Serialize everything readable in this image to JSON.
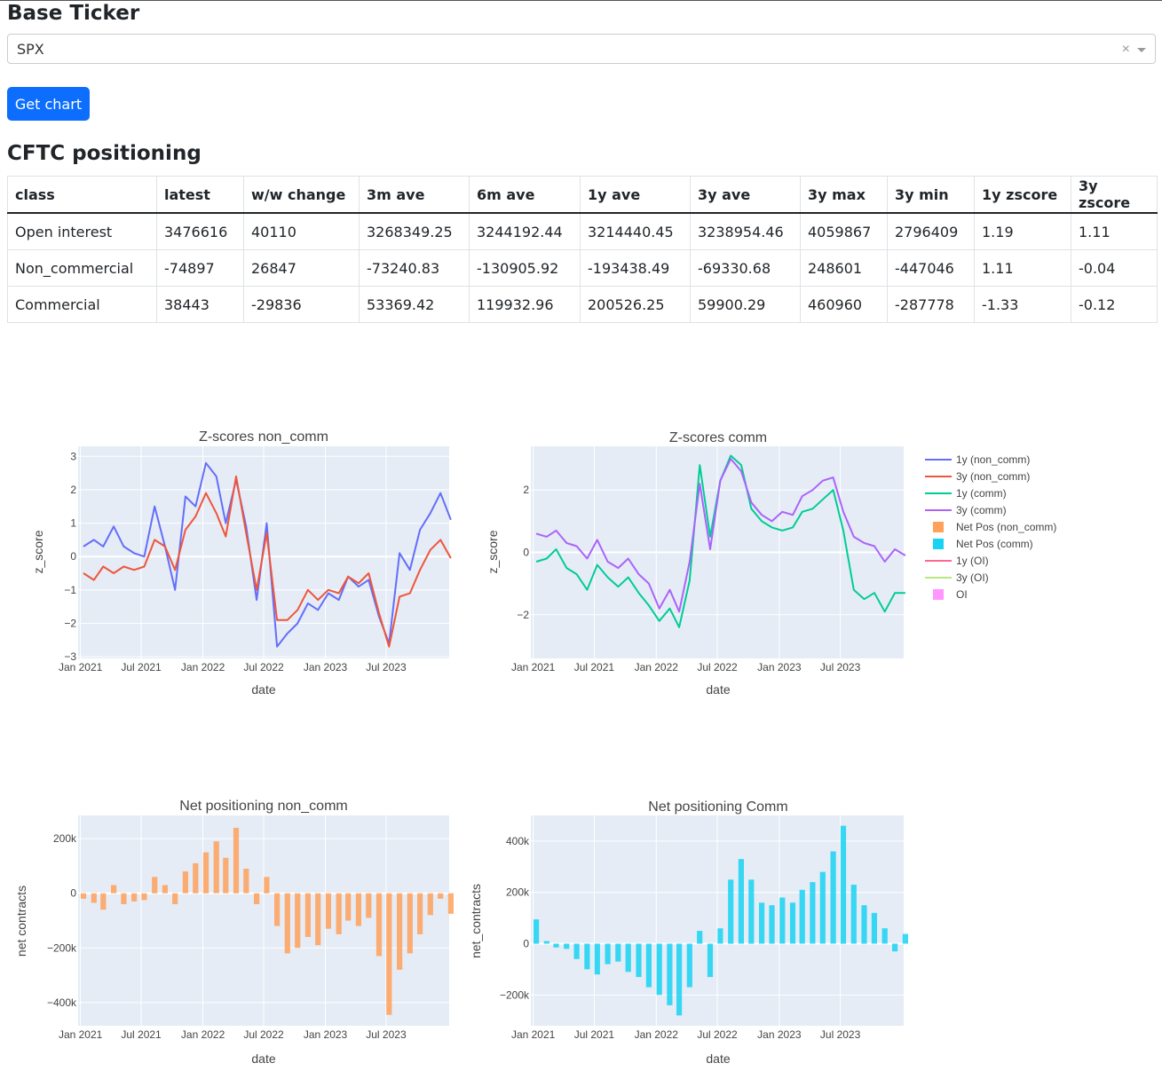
{
  "header": {
    "title": "Base Ticker"
  },
  "ticker_select": {
    "value": "SPX",
    "clear_symbol": "×"
  },
  "get_chart_button": {
    "label": "Get chart"
  },
  "section": {
    "title": "CFTC positioning"
  },
  "table": {
    "columns": [
      "class",
      "latest",
      "w/w change",
      "3m ave",
      "6m ave",
      "1y ave",
      "3y ave",
      "3y max",
      "3y min",
      "1y zscore",
      "3y zscore"
    ],
    "rows": [
      [
        "Open interest",
        "3476616",
        "40110",
        "3268349.25",
        "3244192.44",
        "3214440.45",
        "3238954.46",
        "4059867",
        "2796409",
        "1.19",
        "1.11"
      ],
      [
        "Non_commercial",
        "-74897",
        "26847",
        "-73240.83",
        "-130905.92",
        "-193438.49",
        "-69330.68",
        "248601",
        "-447046",
        "1.11",
        "-0.04"
      ],
      [
        "Commercial",
        "38443",
        "-29836",
        "53369.42",
        "119932.96",
        "200526.25",
        "59900.29",
        "460960",
        "-287778",
        "-1.33",
        "-0.12"
      ]
    ]
  },
  "legend": [
    {
      "label": "1y (non_comm)",
      "color": "#636efa",
      "kind": "line"
    },
    {
      "label": "3y (non_comm)",
      "color": "#ef553b",
      "kind": "line"
    },
    {
      "label": "1y (comm)",
      "color": "#00cc96",
      "kind": "line"
    },
    {
      "label": "3y (comm)",
      "color": "#ab63fa",
      "kind": "line"
    },
    {
      "label": "Net Pos (non_comm)",
      "color": "#ffa15a",
      "kind": "bar"
    },
    {
      "label": "Net Pos (comm)",
      "color": "#19d3f3",
      "kind": "bar"
    },
    {
      "label": "1y (OI)",
      "color": "#ff6692",
      "kind": "line"
    },
    {
      "label": "3y (OI)",
      "color": "#b6e880",
      "kind": "line"
    },
    {
      "label": "OI",
      "color": "#ff97ff",
      "kind": "bar"
    }
  ],
  "chart_data": [
    {
      "type": "line",
      "title": "Z-scores non_comm",
      "xlabel": "date",
      "ylabel": "z_score",
      "x_ticks": [
        "Jan 2021",
        "Jul 2021",
        "Jan 2022",
        "Jul 2022",
        "Jan 2023",
        "Jul 2023"
      ],
      "y_ticks": [
        3,
        2,
        1,
        0,
        -1,
        -2,
        -3
      ],
      "ylim": [
        -3.05,
        3.3
      ],
      "x": [
        "2021-01",
        "2021-02",
        "2021-03",
        "2021-04",
        "2021-05",
        "2021-06",
        "2021-07",
        "2021-08",
        "2021-09",
        "2021-10",
        "2021-11",
        "2021-12",
        "2022-01",
        "2022-02",
        "2022-03",
        "2022-04",
        "2022-05",
        "2022-06",
        "2022-07",
        "2022-08",
        "2022-09",
        "2022-10",
        "2022-11",
        "2022-12",
        "2023-01",
        "2023-02",
        "2023-03",
        "2023-04",
        "2023-05",
        "2023-06",
        "2023-07",
        "2023-08",
        "2023-09",
        "2023-10",
        "2023-11",
        "2023-12",
        "2024-01"
      ],
      "series": [
        {
          "name": "1y (non_comm)",
          "color": "#636efa",
          "values": [
            0.3,
            0.5,
            0.3,
            0.9,
            0.3,
            0.1,
            0.0,
            1.5,
            0.3,
            -1.0,
            1.8,
            1.5,
            2.8,
            2.4,
            1.0,
            2.3,
            0.9,
            -1.3,
            1.0,
            -2.7,
            -2.3,
            -2.0,
            -1.4,
            -1.6,
            -1.1,
            -1.3,
            -0.6,
            -0.9,
            -0.7,
            -1.8,
            -2.6,
            0.1,
            -0.4,
            0.8,
            1.3,
            1.9,
            1.1
          ]
        },
        {
          "name": "3y (non_comm)",
          "color": "#ef553b",
          "values": [
            -0.5,
            -0.7,
            -0.3,
            -0.5,
            -0.3,
            -0.4,
            -0.3,
            0.5,
            0.3,
            -0.4,
            0.8,
            1.2,
            1.9,
            1.3,
            0.6,
            2.4,
            0.7,
            -1.0,
            0.7,
            -1.9,
            -1.9,
            -1.6,
            -1.0,
            -1.3,
            -1.0,
            -1.1,
            -0.6,
            -0.8,
            -0.5,
            -1.7,
            -2.7,
            -1.2,
            -1.1,
            -0.4,
            0.2,
            0.5,
            -0.05
          ]
        }
      ]
    },
    {
      "type": "line",
      "title": "Z-scores comm",
      "xlabel": "date",
      "ylabel": "z_score",
      "x_ticks": [
        "Jan 2021",
        "Jul 2021",
        "Jan 2022",
        "Jul 2022",
        "Jan 2023",
        "Jul 2023"
      ],
      "y_ticks": [
        2,
        0,
        -2
      ],
      "ylim": [
        -3.4,
        3.4
      ],
      "x": [
        "2021-01",
        "2021-02",
        "2021-03",
        "2021-04",
        "2021-05",
        "2021-06",
        "2021-07",
        "2021-08",
        "2021-09",
        "2021-10",
        "2021-11",
        "2021-12",
        "2022-01",
        "2022-02",
        "2022-03",
        "2022-04",
        "2022-05",
        "2022-06",
        "2022-07",
        "2022-08",
        "2022-09",
        "2022-10",
        "2022-11",
        "2022-12",
        "2023-01",
        "2023-02",
        "2023-03",
        "2023-04",
        "2023-05",
        "2023-06",
        "2023-07",
        "2023-08",
        "2023-09",
        "2023-10",
        "2023-11",
        "2023-12",
        "2024-01"
      ],
      "series": [
        {
          "name": "1y (comm)",
          "color": "#00cc96",
          "values": [
            -0.3,
            -0.2,
            0.1,
            -0.5,
            -0.7,
            -1.2,
            -0.4,
            -0.8,
            -1.1,
            -0.8,
            -1.3,
            -1.7,
            -2.2,
            -1.8,
            -2.4,
            -0.9,
            2.8,
            0.5,
            2.3,
            3.1,
            2.8,
            1.4,
            1.0,
            0.8,
            0.7,
            0.8,
            1.3,
            1.4,
            1.7,
            2.0,
            0.7,
            -1.2,
            -1.5,
            -1.3,
            -1.9,
            -1.3,
            -1.3
          ]
        },
        {
          "name": "3y (comm)",
          "color": "#ab63fa",
          "values": [
            0.6,
            0.5,
            0.7,
            0.3,
            0.2,
            -0.2,
            0.4,
            -0.3,
            -0.5,
            -0.2,
            -0.7,
            -1.0,
            -1.8,
            -1.2,
            -1.9,
            -0.3,
            2.2,
            0.1,
            2.3,
            3.0,
            2.6,
            1.6,
            1.2,
            1.0,
            1.3,
            1.2,
            1.8,
            2.0,
            2.3,
            2.4,
            1.3,
            0.5,
            0.3,
            0.2,
            -0.3,
            0.1,
            -0.1
          ]
        }
      ]
    },
    {
      "type": "bar",
      "title": "Net positioning non_comm",
      "xlabel": "date",
      "ylabel": "net contracts",
      "x_ticks": [
        "Jan 2021",
        "Jul 2021",
        "Jan 2022",
        "Jul 2022",
        "Jan 2023",
        "Jul 2023"
      ],
      "y_ticks": [
        "200k",
        "0",
        "−200k",
        "−400k"
      ],
      "y_tick_values": [
        200000,
        0,
        -200000,
        -400000
      ],
      "ylim": [
        -485000,
        285000
      ],
      "color": "#ffa15a",
      "x": [
        "2021-01",
        "2021-02",
        "2021-03",
        "2021-04",
        "2021-05",
        "2021-06",
        "2021-07",
        "2021-08",
        "2021-09",
        "2021-10",
        "2021-11",
        "2021-12",
        "2022-01",
        "2022-02",
        "2022-03",
        "2022-04",
        "2022-05",
        "2022-06",
        "2022-07",
        "2022-08",
        "2022-09",
        "2022-10",
        "2022-11",
        "2022-12",
        "2023-01",
        "2023-02",
        "2023-03",
        "2023-04",
        "2023-05",
        "2023-06",
        "2023-07",
        "2023-08",
        "2023-09",
        "2023-10",
        "2023-11",
        "2023-12",
        "2024-01"
      ],
      "values": [
        -20000,
        -35000,
        -60000,
        30000,
        -40000,
        -30000,
        -25000,
        60000,
        30000,
        -40000,
        80000,
        110000,
        150000,
        190000,
        130000,
        240000,
        90000,
        -40000,
        60000,
        -120000,
        -220000,
        -200000,
        -160000,
        -190000,
        -130000,
        -150000,
        -100000,
        -120000,
        -90000,
        -230000,
        -445000,
        -280000,
        -220000,
        -150000,
        -80000,
        -20000,
        -75000
      ]
    },
    {
      "type": "bar",
      "title": "Net positioning Comm",
      "xlabel": "date",
      "ylabel": "net_contracts",
      "x_ticks": [
        "Jan 2021",
        "Jul 2021",
        "Jan 2022",
        "Jul 2022",
        "Jan 2023",
        "Jul 2023"
      ],
      "y_ticks": [
        "400k",
        "200k",
        "0",
        "−200k"
      ],
      "y_tick_values": [
        400000,
        200000,
        0,
        -200000
      ],
      "ylim": [
        -320000,
        500000
      ],
      "color": "#19d3f3",
      "x": [
        "2021-01",
        "2021-02",
        "2021-03",
        "2021-04",
        "2021-05",
        "2021-06",
        "2021-07",
        "2021-08",
        "2021-09",
        "2021-10",
        "2021-11",
        "2021-12",
        "2022-01",
        "2022-02",
        "2022-03",
        "2022-04",
        "2022-05",
        "2022-06",
        "2022-07",
        "2022-08",
        "2022-09",
        "2022-10",
        "2022-11",
        "2022-12",
        "2023-01",
        "2023-02",
        "2023-03",
        "2023-04",
        "2023-05",
        "2023-06",
        "2023-07",
        "2023-08",
        "2023-09",
        "2023-10",
        "2023-11",
        "2023-12",
        "2024-01"
      ],
      "values": [
        95000,
        10000,
        -15000,
        -20000,
        -60000,
        -100000,
        -120000,
        -80000,
        -70000,
        -110000,
        -130000,
        -170000,
        -200000,
        -240000,
        -280000,
        -170000,
        50000,
        -130000,
        60000,
        250000,
        330000,
        250000,
        160000,
        150000,
        180000,
        160000,
        210000,
        240000,
        280000,
        360000,
        460000,
        230000,
        150000,
        120000,
        60000,
        -30000,
        38000
      ]
    }
  ]
}
